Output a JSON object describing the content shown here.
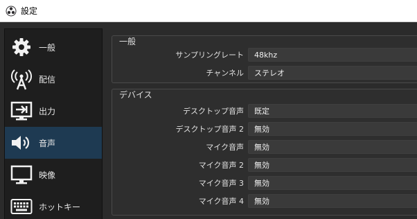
{
  "window": {
    "title": "設定",
    "icon": "obs-logo-icon"
  },
  "sidebar": {
    "items": [
      {
        "label": "一般",
        "icon": "gear-icon"
      },
      {
        "label": "配信",
        "icon": "antenna-icon"
      },
      {
        "label": "出力",
        "icon": "output-icon"
      },
      {
        "label": "音声",
        "icon": "speaker-icon",
        "selected": true
      },
      {
        "label": "映像",
        "icon": "monitor-icon"
      },
      {
        "label": "ホットキー",
        "icon": "keyboard-icon"
      }
    ]
  },
  "general_group": {
    "title": "一般",
    "rows": [
      {
        "label": "サンプリングレート",
        "value": "48khz"
      },
      {
        "label": "チャンネル",
        "value": "ステレオ"
      }
    ]
  },
  "devices_group": {
    "title": "デバイス",
    "rows": [
      {
        "label": "デスクトップ音声",
        "value": "既定"
      },
      {
        "label": "デスクトップ音声 2",
        "value": "無効"
      },
      {
        "label": "マイク音声",
        "value": "無効"
      },
      {
        "label": "マイク音声 2",
        "value": "無効"
      },
      {
        "label": "マイク音声 3",
        "value": "無効"
      },
      {
        "label": "マイク音声 4",
        "value": "無効"
      }
    ]
  },
  "colors": {
    "background": "#2b2b2b",
    "sidebar": "#1e1e1e",
    "selected": "#1e3a52",
    "field": "#3a3a3a",
    "text": "#e0e0e0"
  }
}
